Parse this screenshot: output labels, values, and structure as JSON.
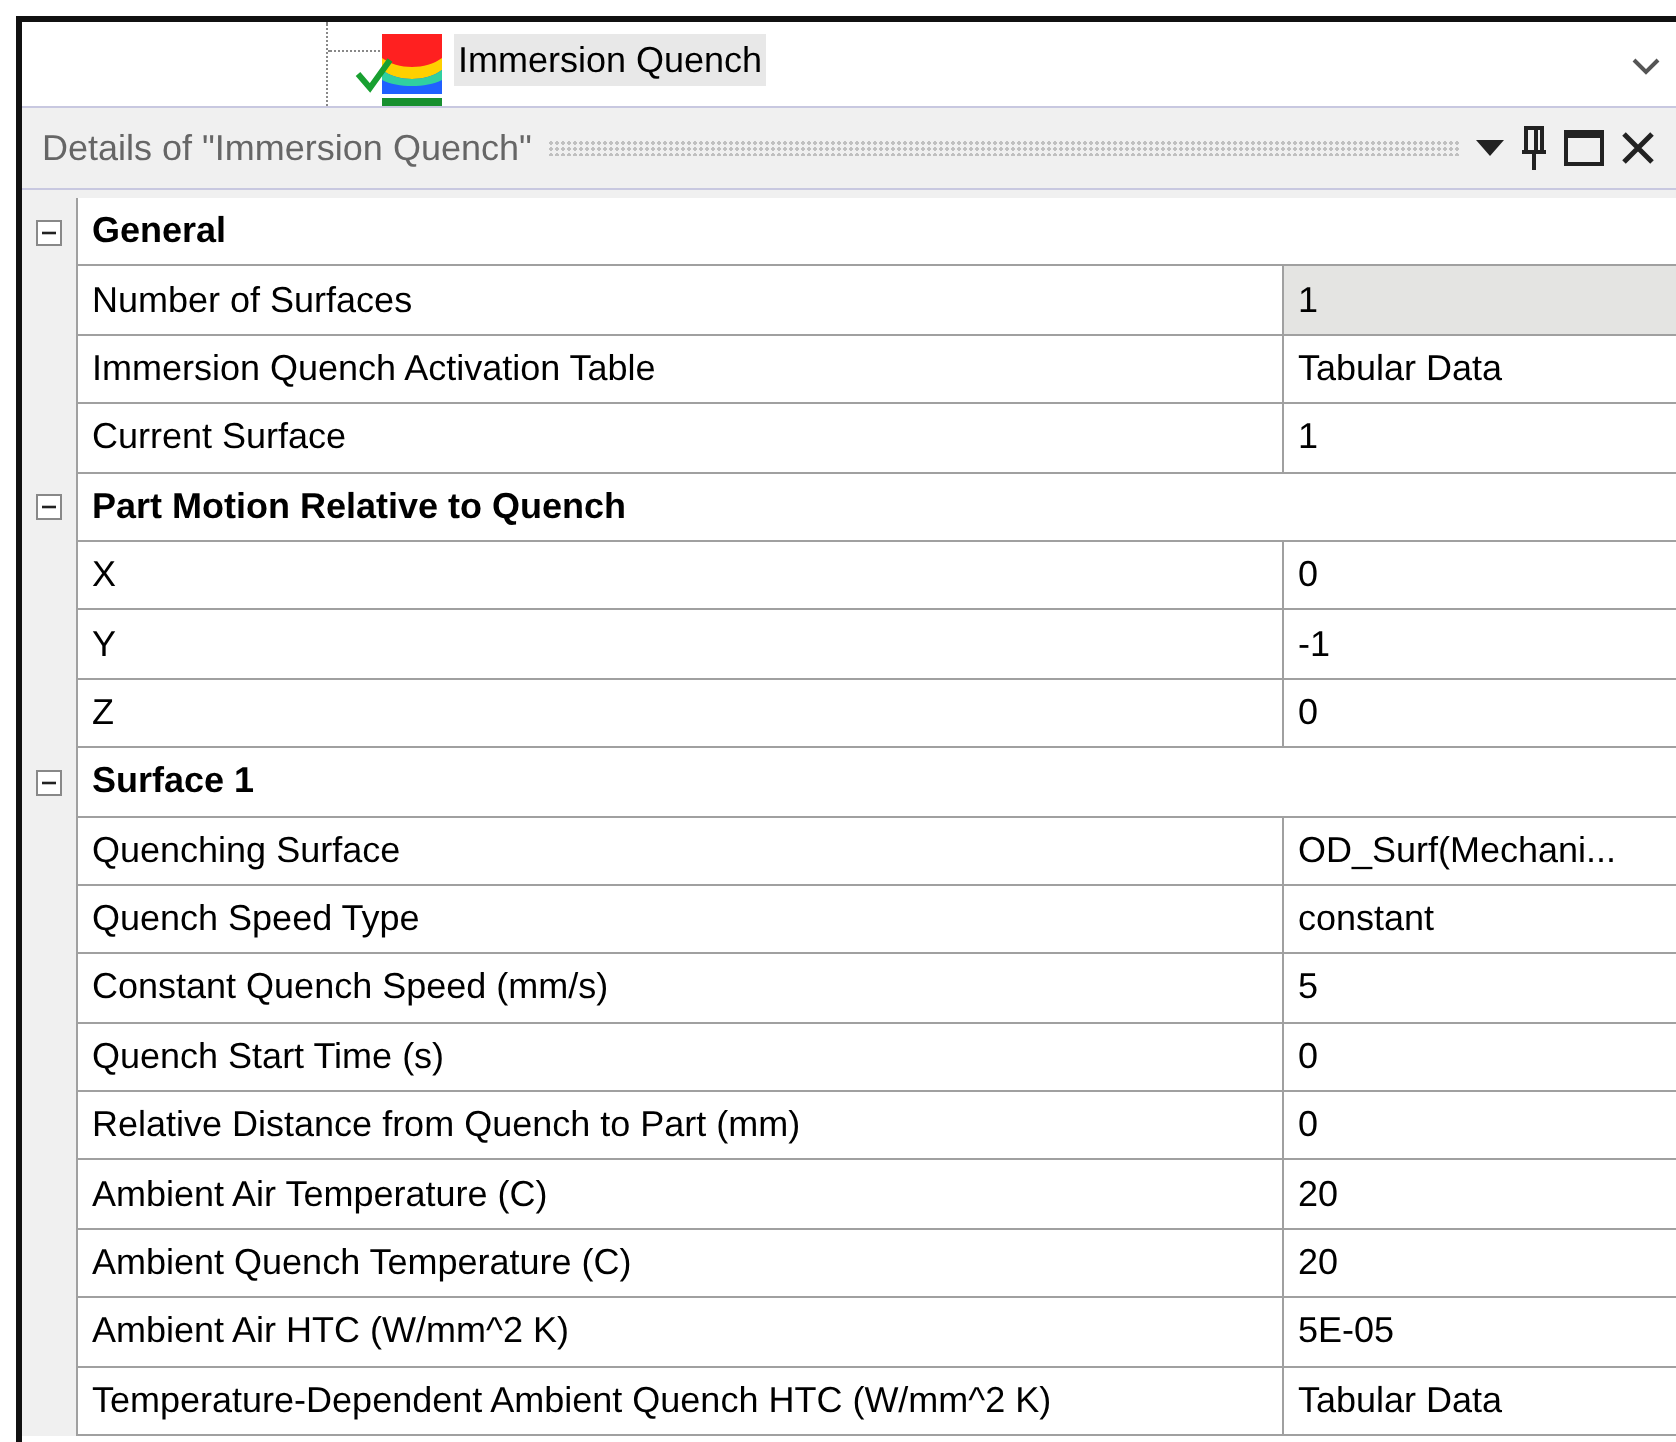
{
  "tree": {
    "item": {
      "label": "Immersion Quench",
      "selected": true
    }
  },
  "details_panel": {
    "title": "Details of \"Immersion Quench\"",
    "sections": [
      {
        "title": "General",
        "expanded": true,
        "rows": [
          {
            "label": "Number of Surfaces",
            "value": "1",
            "selected": true
          },
          {
            "label": "Immersion Quench Activation Table",
            "value": "Tabular Data",
            "selected": false
          },
          {
            "label": "Current Surface",
            "value": "1",
            "selected": false
          }
        ]
      },
      {
        "title": "Part Motion Relative to Quench",
        "expanded": true,
        "rows": [
          {
            "label": "X",
            "value": "0",
            "selected": false
          },
          {
            "label": "Y",
            "value": "-1",
            "selected": false
          },
          {
            "label": "Z",
            "value": "0",
            "selected": false
          }
        ]
      },
      {
        "title": "Surface 1",
        "expanded": true,
        "rows": [
          {
            "label": "Quenching Surface",
            "value": "OD_Surf(Mechani...",
            "selected": false
          },
          {
            "label": "Quench Speed Type",
            "value": "constant",
            "selected": false
          },
          {
            "label": "Constant Quench Speed (mm/s)",
            "value": "5",
            "selected": false
          },
          {
            "label": "Quench Start Time (s)",
            "value": "0",
            "selected": false
          },
          {
            "label": "Relative Distance from Quench to Part (mm)",
            "value": "0",
            "selected": false
          },
          {
            "label": "Ambient Air Temperature (C)",
            "value": "20",
            "selected": false
          },
          {
            "label": "Ambient Quench Temperature (C)",
            "value": "20",
            "selected": false
          },
          {
            "label": "Ambient Air HTC (W/mm^2 K)",
            "value": "5E-05",
            "selected": false
          },
          {
            "label": "Temperature-Dependent Ambient Quench HTC (W/mm^2 K)",
            "value": "Tabular Data",
            "selected": false
          }
        ]
      }
    ]
  }
}
